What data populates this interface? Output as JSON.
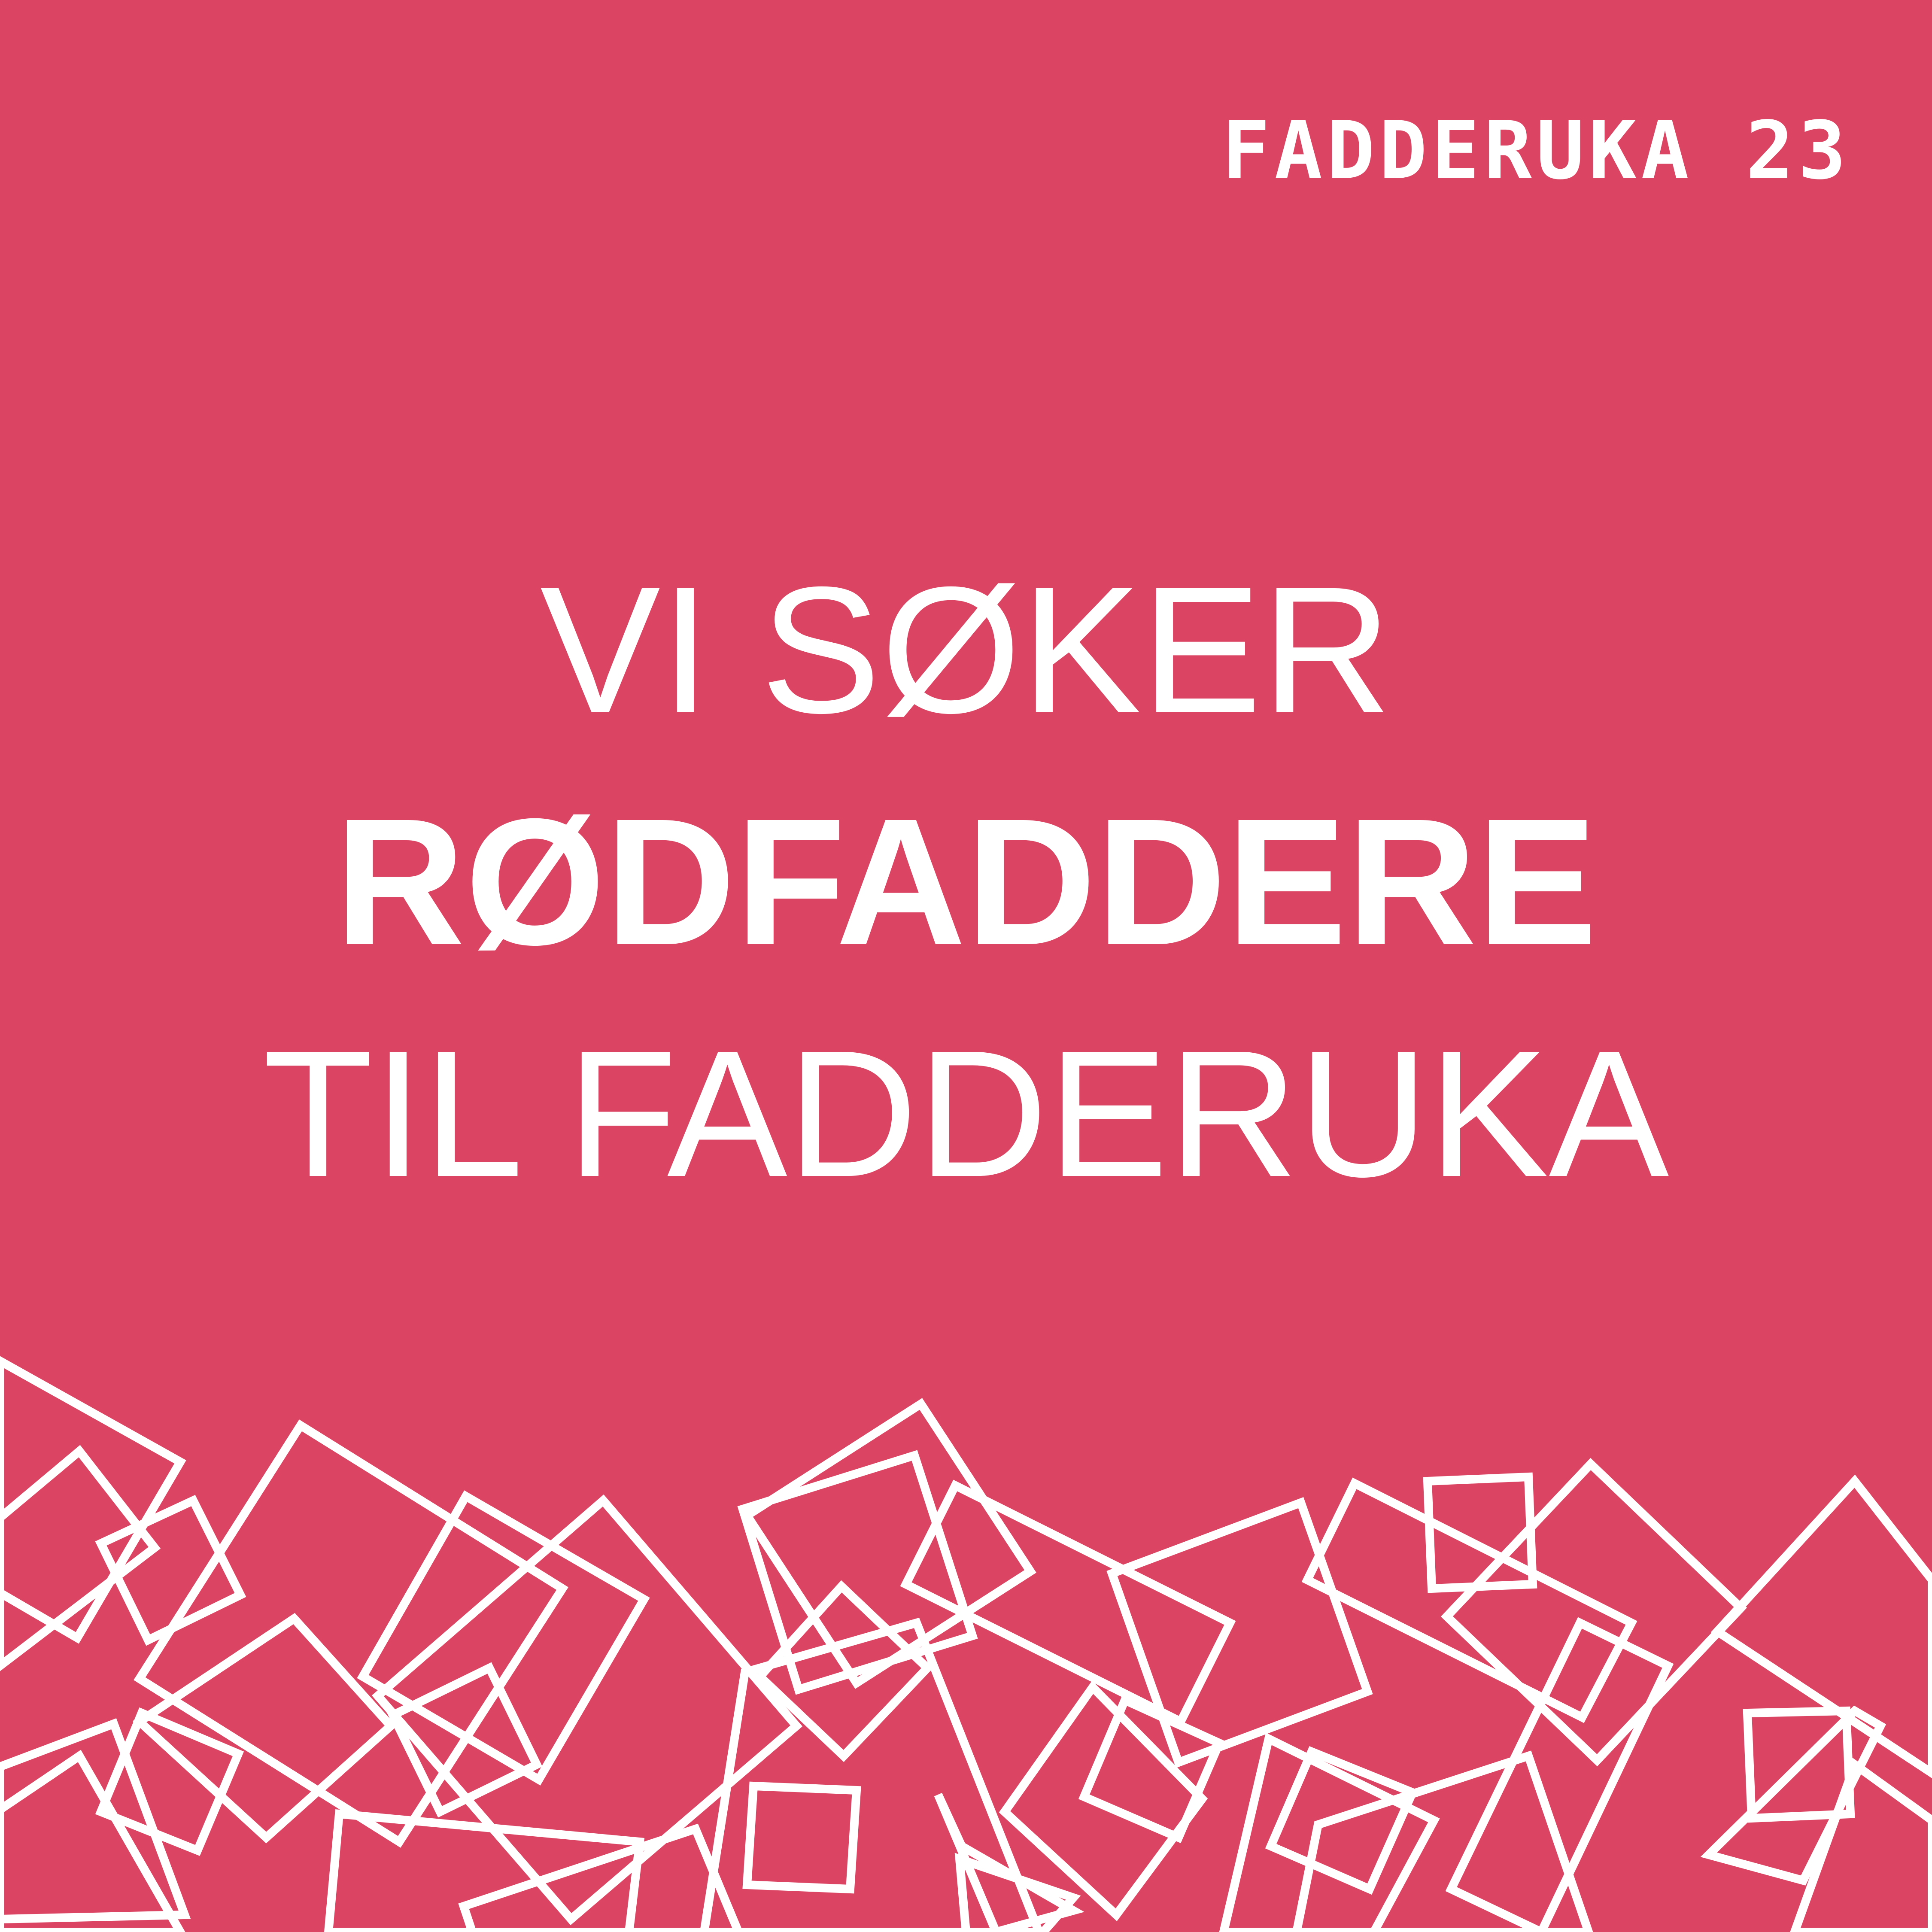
{
  "background_color": "#db4463",
  "foreground_color": "#ffffff",
  "logo": {
    "text": "FADDERUKA 23"
  },
  "headline": {
    "line1": "VI SØKER",
    "line2": "RØDFADDERE",
    "line3": "TIL FADDERUKA"
  },
  "decoration": {
    "icon": "scattered-outline-squares-pattern"
  }
}
